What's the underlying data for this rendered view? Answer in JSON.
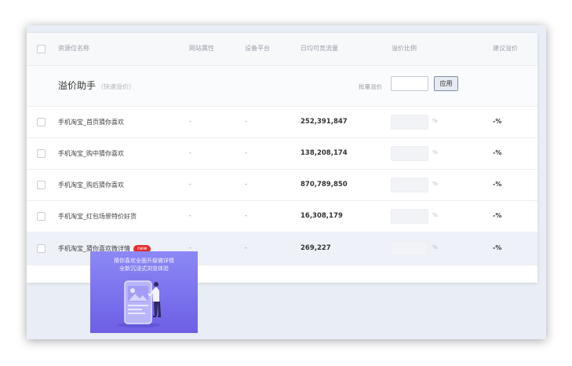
{
  "table": {
    "headers": [
      "资源位名称",
      "网站属性",
      "设备平台",
      "日均可竞流量",
      "溢价比例",
      "建议溢价"
    ],
    "toolbar": {
      "title": "溢价助手",
      "subtitle": "（快速溢价）",
      "batch_label": "批量溢价",
      "batch_value": "",
      "apply_label": "应用"
    },
    "rows": [
      {
        "name": "手机淘宝_首页猜你喜欢",
        "site": "-",
        "platform": "-",
        "traffic": "252,391,847",
        "ratio": "",
        "pct_sign": "%",
        "suggest": "-%"
      },
      {
        "name": "手机淘宝_购中猜你喜欢",
        "site": "-",
        "platform": "-",
        "traffic": "138,208,174",
        "ratio": "",
        "pct_sign": "%",
        "suggest": "-%"
      },
      {
        "name": "手机淘宝_购后猜你喜欢",
        "site": "-",
        "platform": "-",
        "traffic": "870,789,850",
        "ratio": "",
        "pct_sign": "%",
        "suggest": "-%"
      },
      {
        "name": "手机淘宝_红包场景特价好货",
        "site": "-",
        "platform": "-",
        "traffic": "16,308,179",
        "ratio": "",
        "pct_sign": "%",
        "suggest": "-%"
      },
      {
        "name": "手机淘宝_猜你喜欢微详情",
        "badge": "new",
        "site": "-",
        "platform": "-",
        "traffic": "269,227",
        "ratio": "",
        "pct_sign": "%",
        "suggest": "-%"
      }
    ]
  },
  "promo": {
    "line1": "猜你喜欢全面升级微详情",
    "line2": "全新沉浸式浏览体验"
  },
  "colors": {
    "badge": "#e52d2d",
    "promo_top": "#8c88f6",
    "promo_bottom": "#6c5fe4",
    "apply_border": "#7f8ba8"
  }
}
